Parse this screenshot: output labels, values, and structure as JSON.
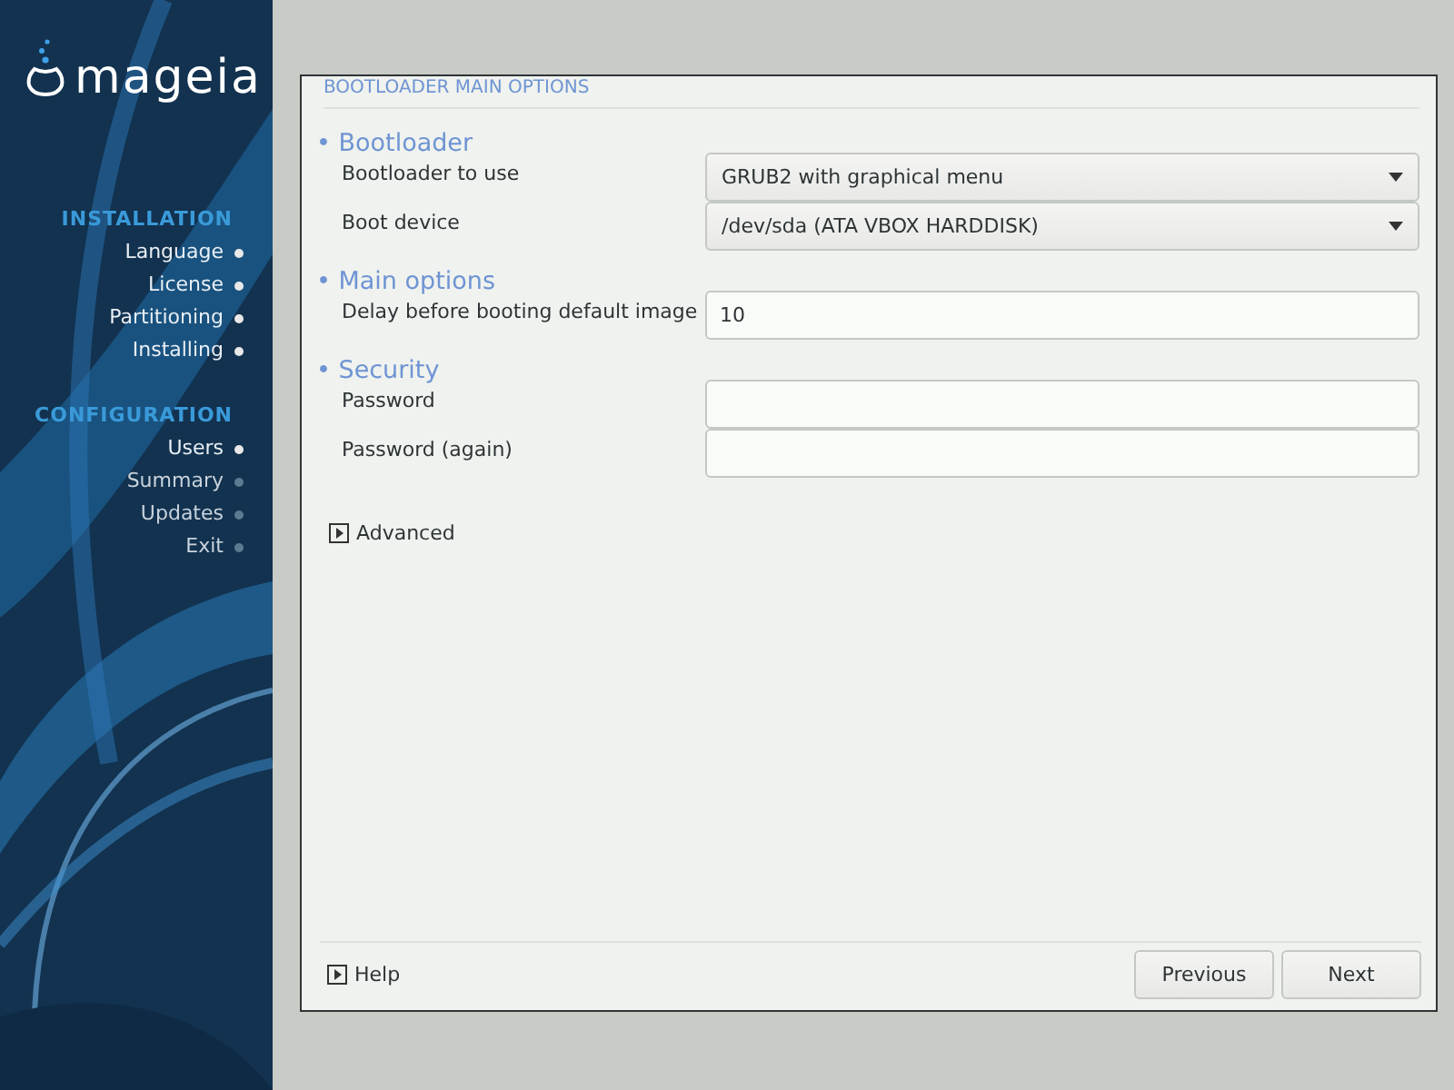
{
  "logo": {
    "text": "mageia"
  },
  "sidebar": {
    "groups": [
      {
        "title": "INSTALLATION",
        "steps": [
          {
            "label": "Language",
            "done": true
          },
          {
            "label": "License",
            "done": true
          },
          {
            "label": "Partitioning",
            "done": true
          },
          {
            "label": "Installing",
            "done": true
          }
        ]
      },
      {
        "title": "CONFIGURATION",
        "steps": [
          {
            "label": "Users",
            "done": true
          },
          {
            "label": "Summary",
            "done": false
          },
          {
            "label": "Updates",
            "done": false
          },
          {
            "label": "Exit",
            "done": false
          }
        ]
      }
    ]
  },
  "page": {
    "title": "BOOTLOADER MAIN OPTIONS",
    "sections": [
      {
        "heading": "• Bootloader",
        "fields": [
          {
            "label": "Bootloader to use",
            "kind": "dropdown",
            "value": "GRUB2 with graphical menu"
          },
          {
            "label": "Boot device",
            "kind": "dropdown",
            "value": "/dev/sda (ATA VBOX HARDDISK)"
          }
        ]
      },
      {
        "heading": "• Main options",
        "fields": [
          {
            "label": "Delay before booting default image",
            "kind": "text",
            "value": "10"
          }
        ]
      },
      {
        "heading": "• Security",
        "fields": [
          {
            "label": "Password",
            "kind": "text"
          },
          {
            "label": "Password (again)",
            "kind": "text"
          }
        ]
      }
    ],
    "advanced": {
      "label": "Advanced",
      "expanded": false
    }
  },
  "footer": {
    "help": "Help",
    "buttons": [
      "Previous",
      "Next"
    ]
  }
}
